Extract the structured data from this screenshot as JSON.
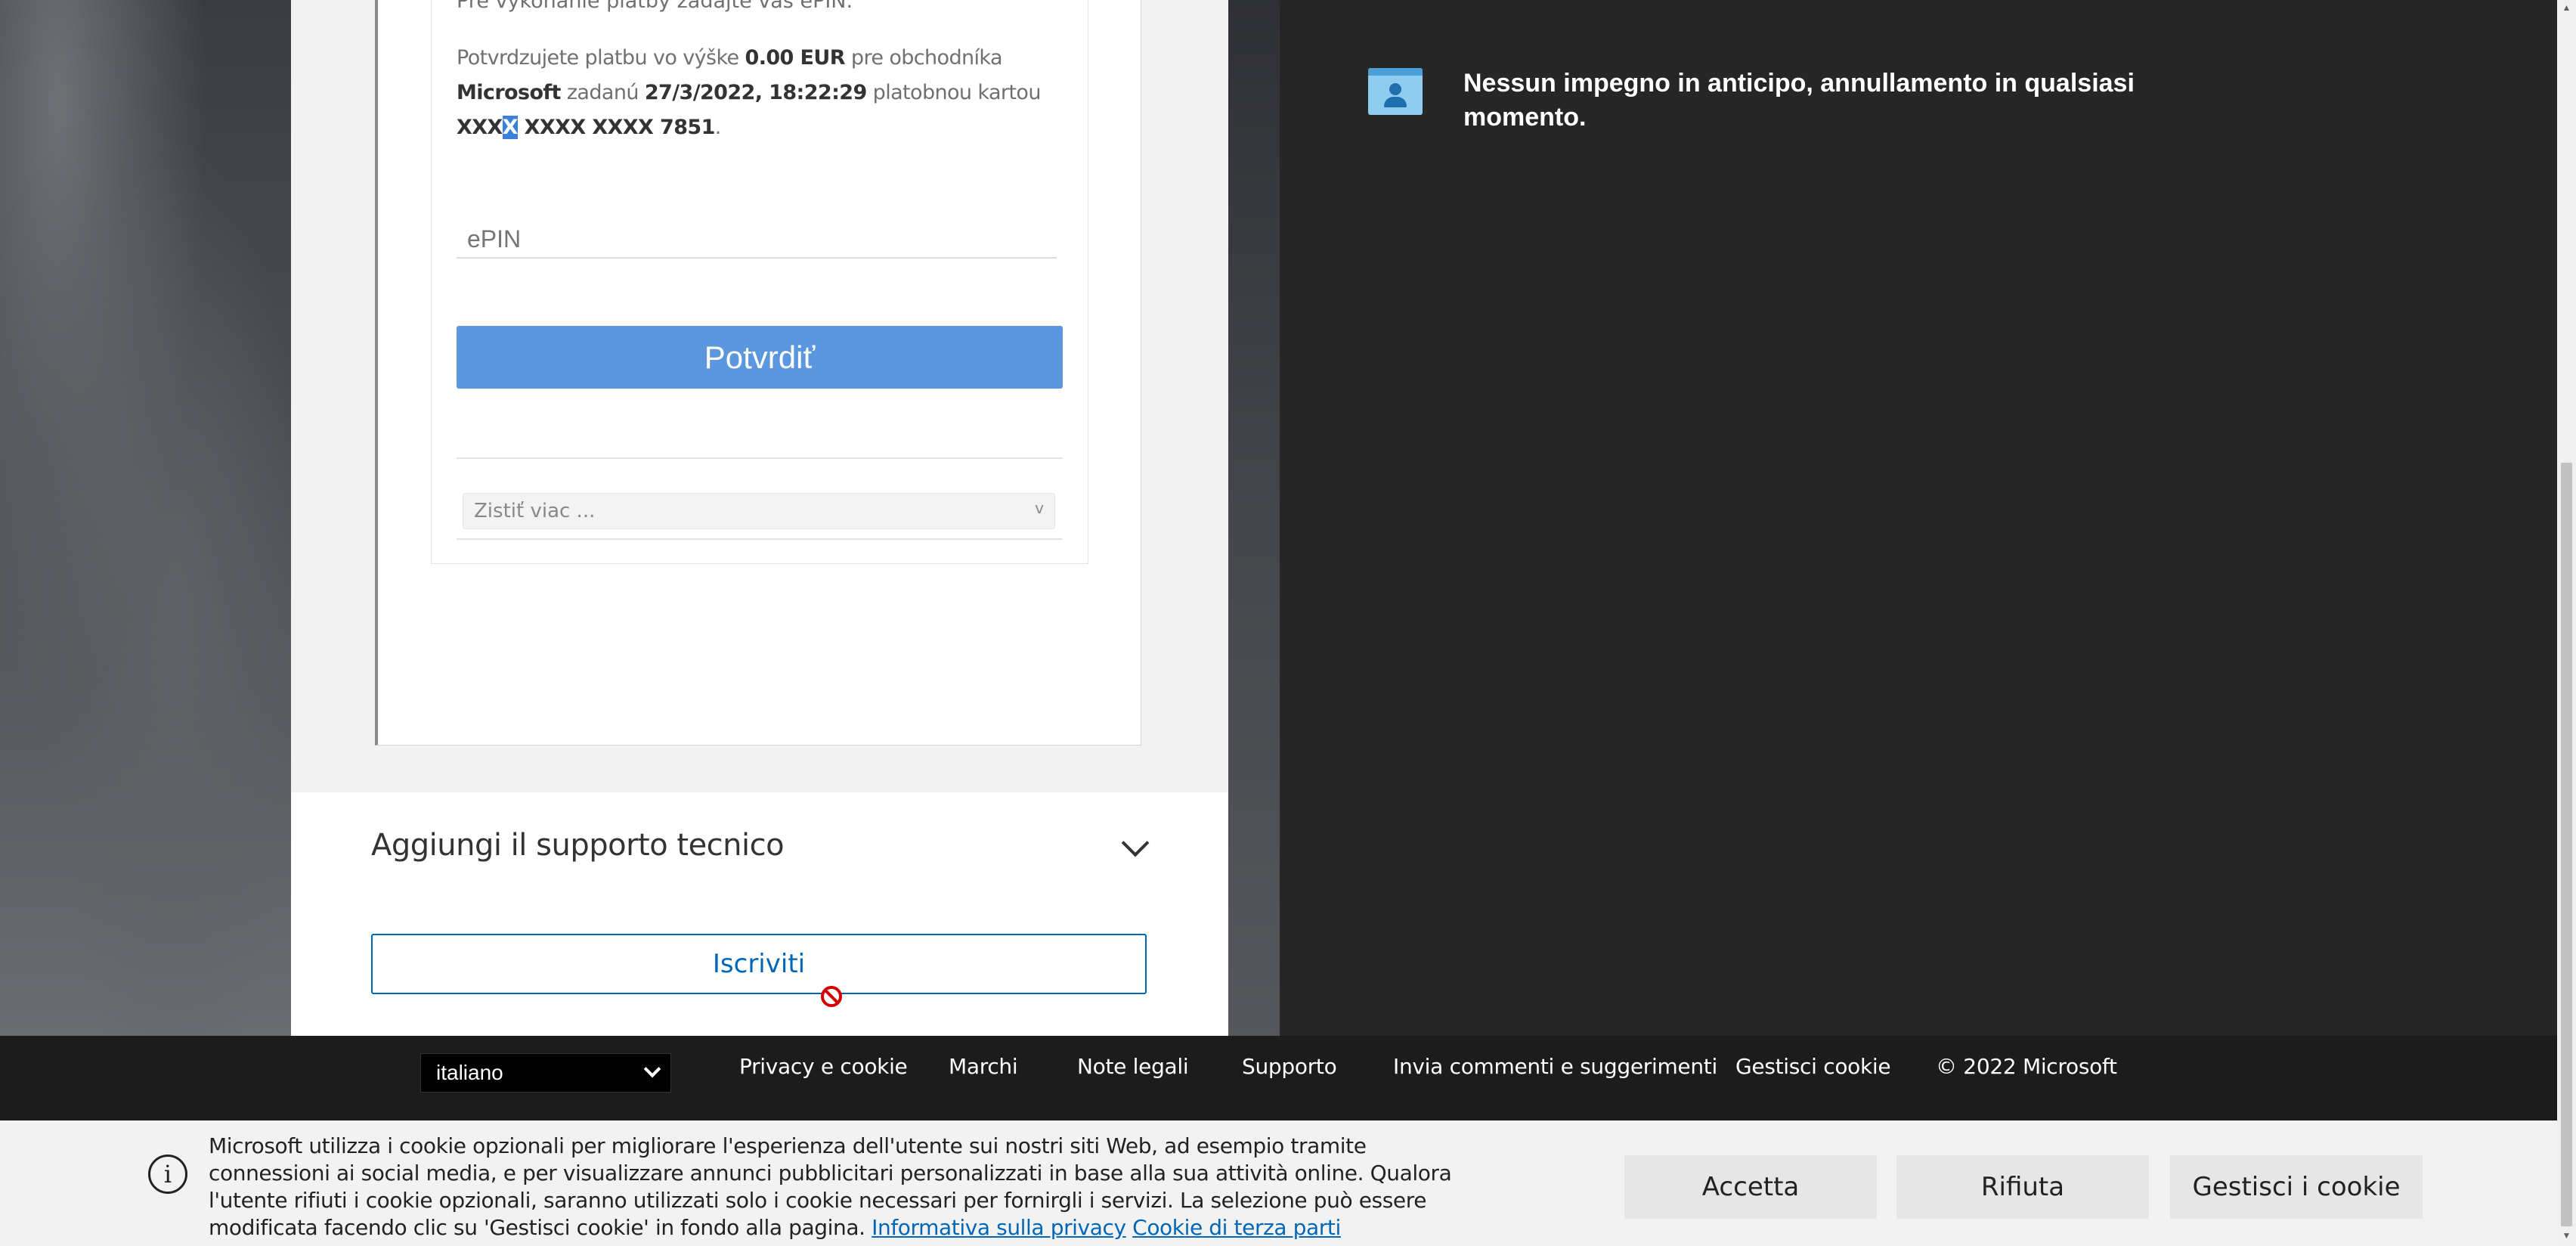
{
  "promo": {
    "text": "Nessun impegno in anticipo, annullamento in qualsiasi momento."
  },
  "payment": {
    "intro_text": "Pre vykonanie platby zadajte váš ePIN.",
    "line_prefix": "Potvrdzujete platbu vo výške ",
    "amount": "0.00 EUR",
    "line_mid1": " pre obchodníka ",
    "merchant": "Microsoft",
    "line_mid2": " zadanú ",
    "datetime": "27/3/2022, 18:22:29",
    "line_mid3": " platobnou kartou ",
    "card_part1": "XXX",
    "card_sel": "X",
    "card_part2": " XXXX XXXX 7851",
    "line_end": ".",
    "epin_placeholder": "ePIN",
    "confirm_label": "Potvrdiť",
    "more_label": "Zistiť viac ...",
    "more_chevron": "v"
  },
  "support": {
    "label": "Aggiungi il supporto tecnico"
  },
  "signup": {
    "label": "Iscriviti"
  },
  "footer": {
    "language": "italiano",
    "links": {
      "privacy": "Privacy e cookie",
      "trademarks": "Marchi",
      "legal": "Note legali",
      "support": "Supporto",
      "feedback": "Invia commenti e suggerimenti",
      "manage_cookies": "Gestisci cookie",
      "copyright": "© 2022 Microsoft"
    }
  },
  "cookie_banner": {
    "icon": "info-icon",
    "text": "Microsoft utilizza i cookie opzionali per migliorare l'esperienza dell'utente sui nostri siti Web, ad esempio tramite connessioni ai social media, e per visualizzare annunci pubblicitari personalizzati in base alla sua attività online. Qualora l'utente rifiuti i cookie opzionali, saranno utilizzati solo i cookie necessari per fornirgli i servizi. La selezione può essere modificata facendo clic su 'Gestisci cookie' in fondo alla pagina.",
    "privacy_link": "Informativa sulla privacy",
    "third_party_link": "Cookie di terza parti",
    "accept_label": "Accetta",
    "reject_label": "Rifiuta",
    "manage_label": "Gestisci i cookie"
  },
  "colors": {
    "accent_blue": "#0067b8",
    "confirm_button": "#5b97de",
    "dark_panel": "#262626"
  }
}
